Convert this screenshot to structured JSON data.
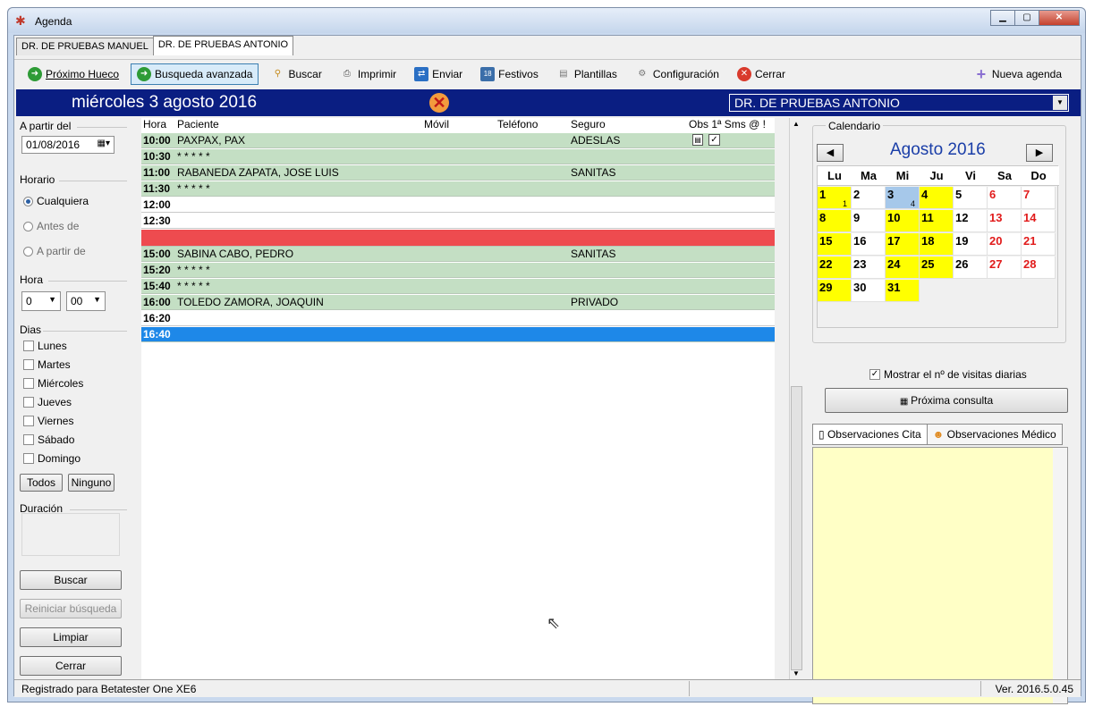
{
  "window": {
    "title": "Agenda"
  },
  "doctor_tabs": [
    "DR. DE PRUEBAS MANUEL",
    "DR. DE PRUEBAS ANTONIO"
  ],
  "toolbar": {
    "proximo_hueco": "Próximo Hueco",
    "busqueda_avanzada": "Busqueda avanzada",
    "buscar": "Buscar",
    "imprimir": "Imprimir",
    "enviar": "Enviar",
    "festivos": "Festivos",
    "plantillas": "Plantillas",
    "configuracion": "Configuración",
    "cerrar": "Cerrar",
    "nueva_agenda": "Nueva agenda"
  },
  "header": {
    "date": "miércoles 3 agosto 2016",
    "doctor": "DR. DE PRUEBAS ANTONIO"
  },
  "left": {
    "a_partir_del_label": "A partir del",
    "date_value": "01/08/2016",
    "horario_label": "Horario",
    "radios": [
      "Cualquiera",
      "Antes de",
      "A partir de"
    ],
    "hora_label": "Hora",
    "hora_value": "0",
    "minuto_value": "00",
    "dias_label": "Dias",
    "days": [
      "Lunes",
      "Martes",
      "Miércoles",
      "Jueves",
      "Viernes",
      "Sábado",
      "Domingo"
    ],
    "todos": "Todos",
    "ninguno": "Ninguno",
    "duracion_label": "Duración",
    "buscar": "Buscar",
    "reiniciar": "Reiniciar búsqueda",
    "limpiar": "Limpiar",
    "cerrar": "Cerrar"
  },
  "grid": {
    "columns": {
      "hora": "Hora",
      "paciente": "Paciente",
      "movil": "Móvil",
      "telefono": "Teléfono",
      "seguro": "Seguro",
      "flags": "Obs 1ª Sms @  !"
    },
    "rows": [
      {
        "time": "10:00",
        "patient": "PAXPAX, PAX",
        "insurance": "ADESLAS",
        "style": "green"
      },
      {
        "time": "10:30",
        "patient": "* * * * *",
        "insurance": "",
        "style": "green"
      },
      {
        "time": "11:00",
        "patient": "RABANEDA ZAPATA, JOSE LUIS",
        "insurance": "SANITAS",
        "style": "green"
      },
      {
        "time": "11:30",
        "patient": "* * * * *",
        "insurance": "",
        "style": "green"
      },
      {
        "time": "12:00",
        "patient": "",
        "insurance": "",
        "style": "white"
      },
      {
        "time": "12:30",
        "patient": "",
        "insurance": "",
        "style": "white"
      },
      {
        "time": "",
        "patient": "",
        "insurance": "",
        "style": "red"
      },
      {
        "time": "15:00",
        "patient": "SABINA CABO, PEDRO",
        "insurance": "SANITAS",
        "style": "green"
      },
      {
        "time": "15:20",
        "patient": "* * * * *",
        "insurance": "",
        "style": "green"
      },
      {
        "time": "15:40",
        "patient": "* * * * *",
        "insurance": "",
        "style": "green"
      },
      {
        "time": "16:00",
        "patient": "TOLEDO ZAMORA, JOAQUIN",
        "insurance": "PRIVADO",
        "style": "green"
      },
      {
        "time": "16:20",
        "patient": "",
        "insurance": "",
        "style": "white"
      },
      {
        "time": "16:40",
        "patient": "",
        "insurance": "",
        "style": "blue"
      }
    ]
  },
  "calendar": {
    "label": "Calendario",
    "month": "Agosto 2016",
    "weekdays": [
      "Lu",
      "Ma",
      "Mi",
      "Ju",
      "Vi",
      "Sa",
      "Do"
    ],
    "cells": [
      {
        "d": "1",
        "style": "yellow",
        "count": "1"
      },
      {
        "d": "2",
        "style": ""
      },
      {
        "d": "3",
        "style": "sel",
        "count": "4"
      },
      {
        "d": "4",
        "style": "yellow"
      },
      {
        "d": "5",
        "style": ""
      },
      {
        "d": "6",
        "style": "we"
      },
      {
        "d": "7",
        "style": "we"
      },
      {
        "d": "8",
        "style": "yellow"
      },
      {
        "d": "9",
        "style": ""
      },
      {
        "d": "10",
        "style": "yellow"
      },
      {
        "d": "11",
        "style": "yellow"
      },
      {
        "d": "12",
        "style": ""
      },
      {
        "d": "13",
        "style": "we"
      },
      {
        "d": "14",
        "style": "we"
      },
      {
        "d": "15",
        "style": "yellow"
      },
      {
        "d": "16",
        "style": ""
      },
      {
        "d": "17",
        "style": "yellow"
      },
      {
        "d": "18",
        "style": "yellow"
      },
      {
        "d": "19",
        "style": ""
      },
      {
        "d": "20",
        "style": "we"
      },
      {
        "d": "21",
        "style": "we"
      },
      {
        "d": "22",
        "style": "yellow"
      },
      {
        "d": "23",
        "style": ""
      },
      {
        "d": "24",
        "style": "yellow"
      },
      {
        "d": "25",
        "style": "yellow"
      },
      {
        "d": "26",
        "style": ""
      },
      {
        "d": "27",
        "style": "we"
      },
      {
        "d": "28",
        "style": "we"
      },
      {
        "d": "29",
        "style": "yellow"
      },
      {
        "d": "30",
        "style": ""
      },
      {
        "d": "31",
        "style": "yellow"
      }
    ],
    "show_visits": "Mostrar el nº de visitas diarias",
    "proxima": "Próxima consulta"
  },
  "obs_tabs": [
    "Observaciones Cita",
    "Observaciones Médico"
  ],
  "status": {
    "left": "Registrado para Betatester One XE6",
    "right": "Ver. 2016.5.0.45"
  }
}
